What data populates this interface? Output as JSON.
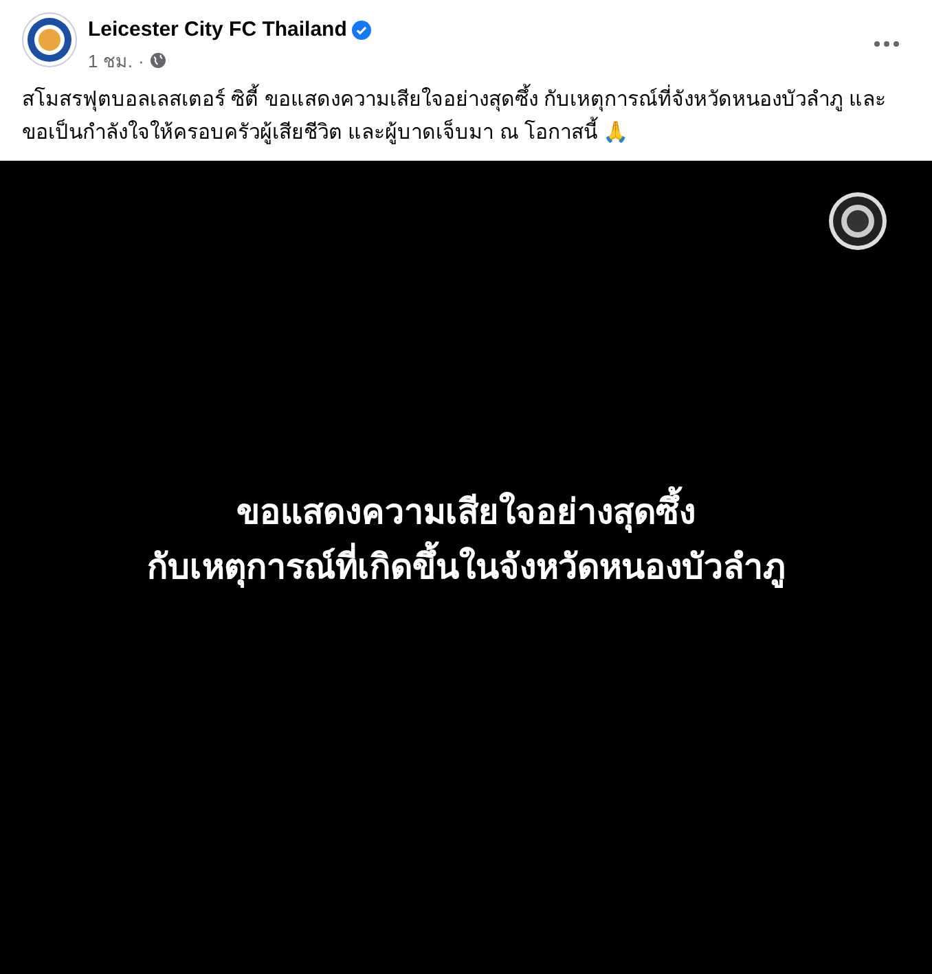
{
  "post": {
    "author": "Leicester City FC Thailand",
    "verified": true,
    "time": "1 ชม.",
    "separator": "·",
    "text": "สโมสรฟุตบอลเลสเตอร์ ซิตี้ ขอแสดงความเสียใจอย่างสุดซึ้ง กับเหตุการณ์ที่จังหวัดหนองบัวลำภู และขอเป็นกำลังใจให้ครอบครัวผู้เสียชีวิต และผู้บาดเจ็บมา ณ โอกาสนี้ 🙏"
  },
  "media": {
    "lines": [
      "ขอแสดงความเสียใจอย่างสุดซึ้ง",
      "กับเหตุการณ์ที่เกิดขึ้นในจังหวัดหนองบัวลำภู"
    ]
  }
}
